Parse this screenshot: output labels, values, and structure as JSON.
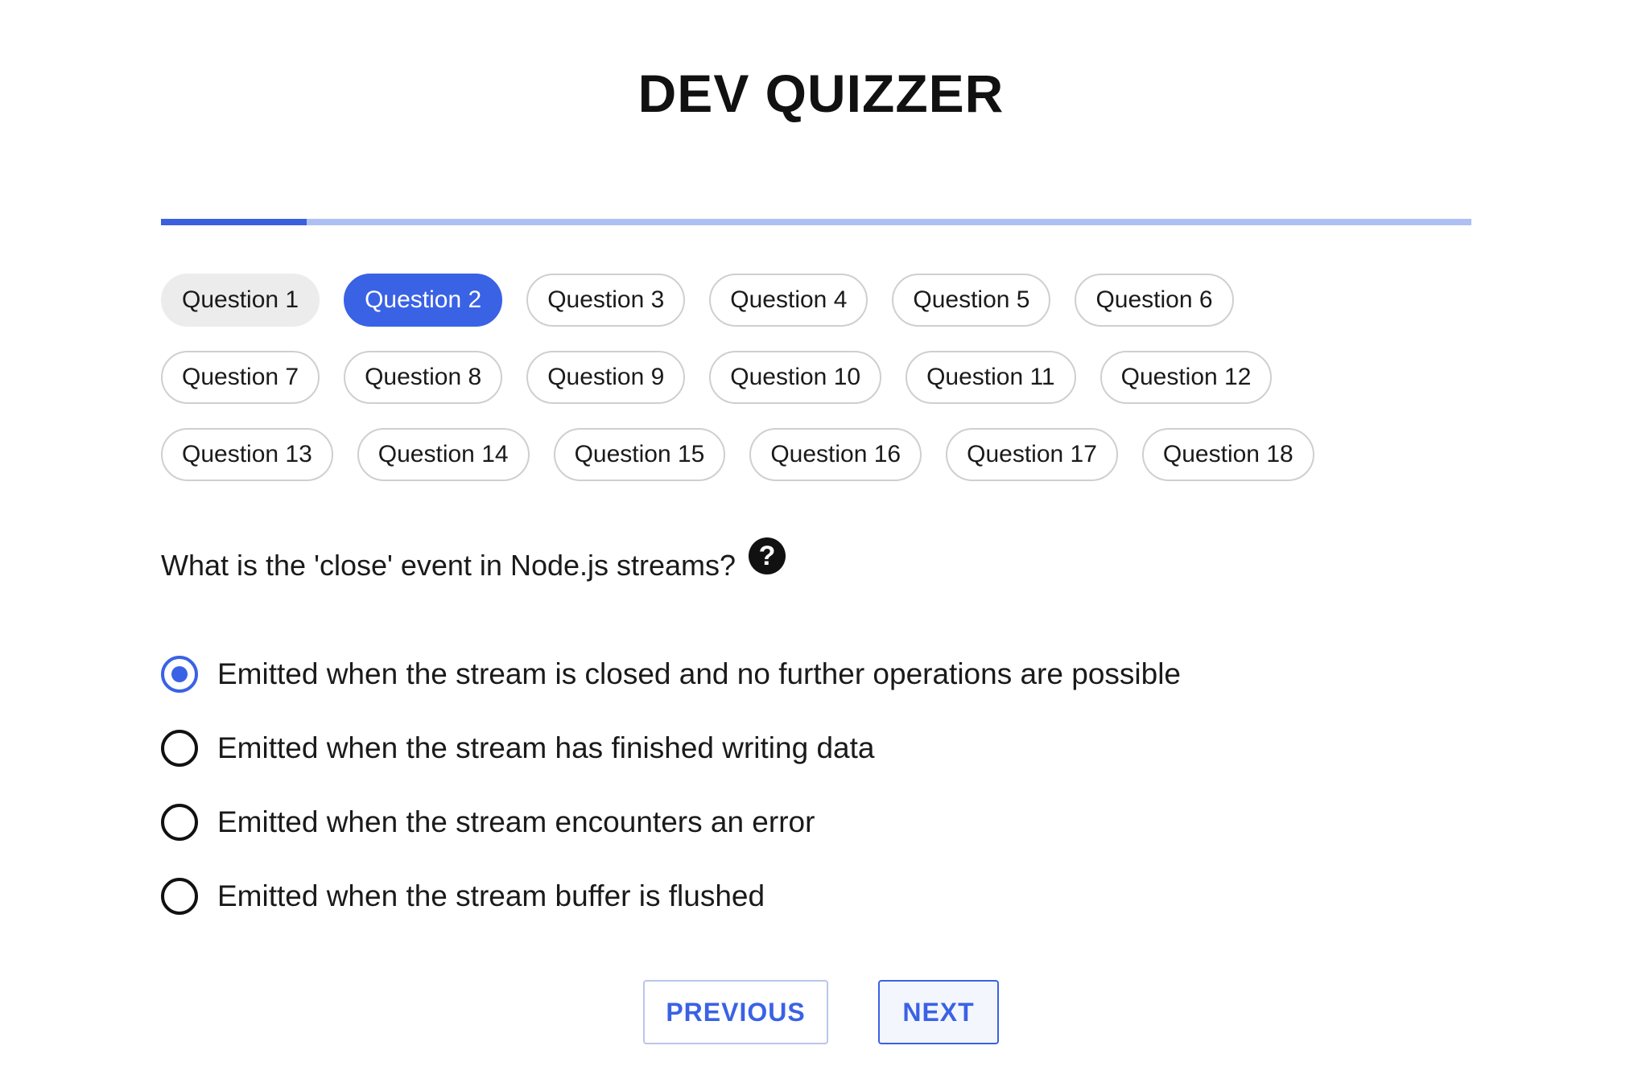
{
  "app": {
    "title": "DEV QUIZZER"
  },
  "progress": {
    "fraction": 0.111
  },
  "colors": {
    "accent": "#3a62e5",
    "progress_track": "#aebff3",
    "visited_pill": "#ececec"
  },
  "questions_nav": [
    {
      "label": "Question 1",
      "state": "visited"
    },
    {
      "label": "Question 2",
      "state": "current"
    },
    {
      "label": "Question 3",
      "state": "default"
    },
    {
      "label": "Question 4",
      "state": "default"
    },
    {
      "label": "Question 5",
      "state": "default"
    },
    {
      "label": "Question 6",
      "state": "default"
    },
    {
      "label": "Question 7",
      "state": "default"
    },
    {
      "label": "Question 8",
      "state": "default"
    },
    {
      "label": "Question 9",
      "state": "default"
    },
    {
      "label": "Question 10",
      "state": "default"
    },
    {
      "label": "Question 11",
      "state": "default"
    },
    {
      "label": "Question 12",
      "state": "default"
    },
    {
      "label": "Question 13",
      "state": "default"
    },
    {
      "label": "Question 14",
      "state": "default"
    },
    {
      "label": "Question 15",
      "state": "default"
    },
    {
      "label": "Question 16",
      "state": "default"
    },
    {
      "label": "Question 17",
      "state": "default"
    },
    {
      "label": "Question 18",
      "state": "default"
    }
  ],
  "question": {
    "text": "What is the 'close' event in Node.js streams?",
    "help_icon": "question-circle-icon",
    "help_glyph": "?"
  },
  "options": [
    {
      "label": "Emitted when the stream is closed and no further operations are possible",
      "selected": true
    },
    {
      "label": "Emitted when the stream has finished writing data",
      "selected": false
    },
    {
      "label": "Emitted when the stream encounters an error",
      "selected": false
    },
    {
      "label": "Emitted when the stream buffer is flushed",
      "selected": false
    }
  ],
  "navigation": {
    "previous_label": "PREVIOUS",
    "next_label": "NEXT"
  }
}
